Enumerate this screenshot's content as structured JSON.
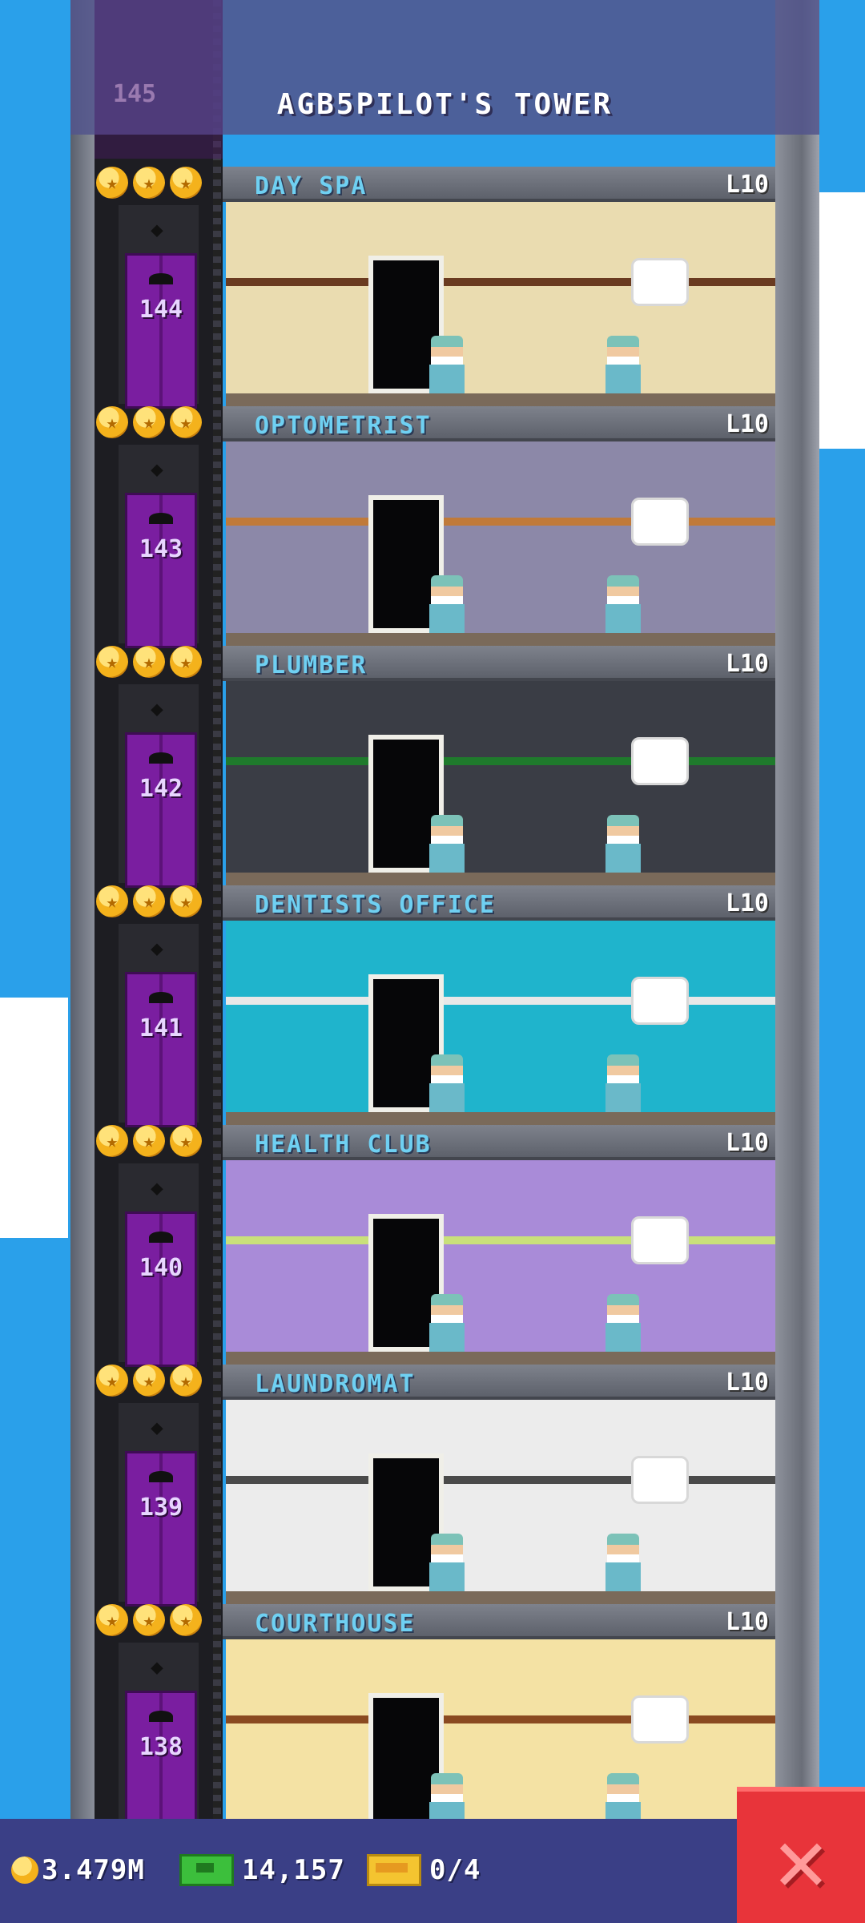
{
  "tower": {
    "title": "AGB5PILOT'S TOWER",
    "top_partial_floor_number": "145"
  },
  "floors": [
    {
      "number": "144",
      "name": "DAY SPA",
      "level": "L10",
      "stars": 3,
      "wall": "#eadcb0",
      "accent": "#6a3b20"
    },
    {
      "number": "143",
      "name": "OPTOMETRIST",
      "level": "L10",
      "stars": 3,
      "wall": "#8c88a8",
      "accent": "#c07a3a"
    },
    {
      "number": "142",
      "name": "PLUMBER",
      "level": "L10",
      "stars": 3,
      "wall": "#3a3d45",
      "accent": "#1f7a2c"
    },
    {
      "number": "141",
      "name": "DENTISTS OFFICE",
      "level": "L10",
      "stars": 3,
      "wall": "#1fb4cc",
      "accent": "#e8e8e8"
    },
    {
      "number": "140",
      "name": "HEALTH CLUB",
      "level": "L10",
      "stars": 3,
      "wall": "#a98bd8",
      "accent": "#c9e07a"
    },
    {
      "number": "139",
      "name": "LAUNDROMAT",
      "level": "L10",
      "stars": 3,
      "wall": "#ececec",
      "accent": "#4a4a4a"
    },
    {
      "number": "138",
      "name": "COURTHOUSE",
      "level": "L10",
      "stars": 3,
      "wall": "#f4e2a4",
      "accent": "#8a4a20"
    }
  ],
  "status_bar": {
    "coins": "3.479M",
    "bux": "14,157",
    "tickets": "0/4"
  },
  "icons": {
    "coin": "coin-icon",
    "bux": "bux-icon",
    "ticket": "ticket-icon",
    "close": "close-icon",
    "star": "star-icon"
  },
  "colors": {
    "sky": "#2aa0ea",
    "floor_name": "#6fd0f2",
    "close_button": "#e8343a",
    "bottom_bar": "#3a3f86"
  }
}
